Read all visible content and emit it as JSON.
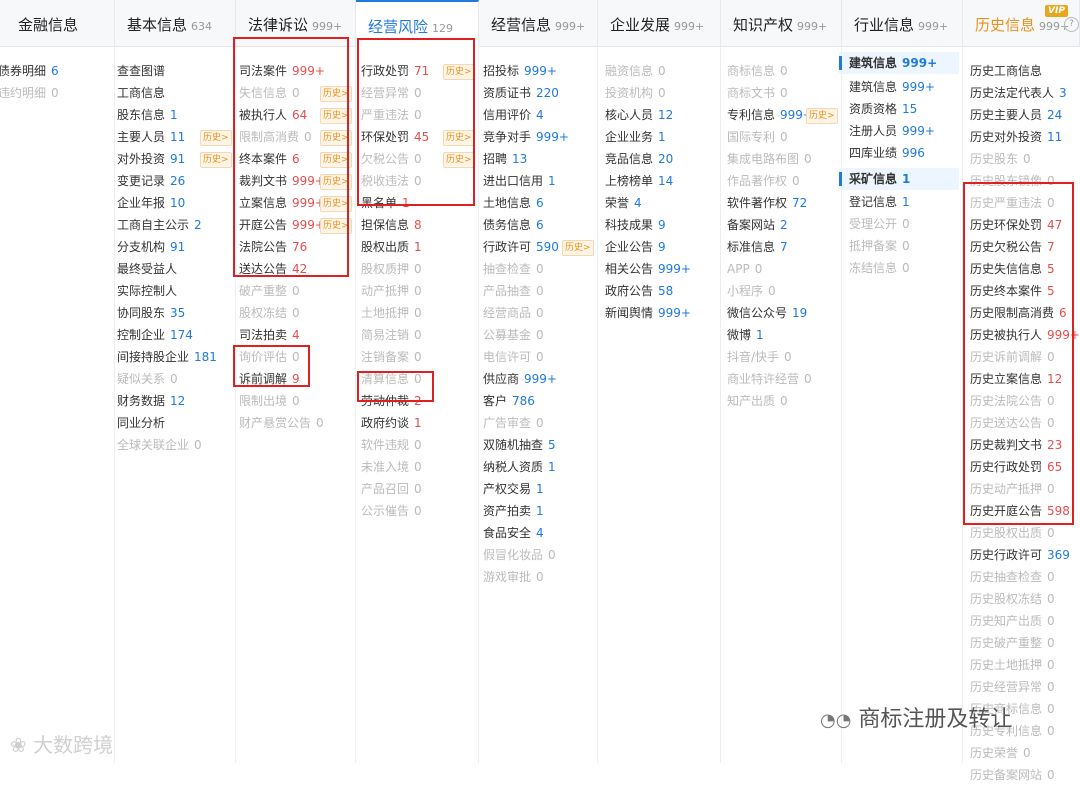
{
  "tabs": [
    {
      "label": "金融信息",
      "count": "",
      "active": false,
      "history": false,
      "vip": ""
    },
    {
      "label": "基本信息",
      "count": "634",
      "active": false,
      "history": false,
      "vip": ""
    },
    {
      "label": "法律诉讼",
      "count": "999+",
      "active": false,
      "history": false,
      "vip": ""
    },
    {
      "label": "经营风险",
      "count": "129",
      "active": true,
      "history": false,
      "vip": ""
    },
    {
      "label": "经营信息",
      "count": "999+",
      "active": false,
      "history": false,
      "vip": ""
    },
    {
      "label": "企业发展",
      "count": "999+",
      "active": false,
      "history": false,
      "vip": ""
    },
    {
      "label": "知识产权",
      "count": "999+",
      "active": false,
      "history": false,
      "vip": ""
    },
    {
      "label": "行业信息",
      "count": "999+",
      "active": false,
      "history": false,
      "vip": ""
    },
    {
      "label": "历史信息",
      "count": "999+",
      "active": false,
      "history": true,
      "vip": "VIP"
    }
  ],
  "columns": [
    [
      {
        "label": "债券明细",
        "count": "6"
      },
      {
        "label": "违约明细",
        "count": "0",
        "disabled": true
      }
    ],
    [
      {
        "label": "查查图谱"
      },
      {
        "label": "工商信息"
      },
      {
        "label": "股东信息",
        "count": "1"
      },
      {
        "label": "主要人员",
        "count": "11",
        "badge": "历史>"
      },
      {
        "label": "对外投资",
        "count": "91",
        "badge": "历史>"
      },
      {
        "label": "变更记录",
        "count": "26"
      },
      {
        "label": "企业年报",
        "count": "10"
      },
      {
        "label": "工商自主公示",
        "count": "2"
      },
      {
        "label": "分支机构",
        "count": "91"
      },
      {
        "label": "最终受益人"
      },
      {
        "label": "实际控制人"
      },
      {
        "label": "协同股东",
        "count": "35"
      },
      {
        "label": "控制企业",
        "count": "174"
      },
      {
        "label": "间接持股企业",
        "count": "181"
      },
      {
        "label": "疑似关系",
        "count": "0",
        "disabled": true
      },
      {
        "label": "财务数据",
        "count": "12"
      },
      {
        "label": "同业分析"
      },
      {
        "label": "全球关联企业",
        "count": "0",
        "disabled": true
      }
    ],
    [
      {
        "label": "司法案件",
        "count": "999+",
        "red": true
      },
      {
        "label": "失信信息",
        "count": "0",
        "disabled": true,
        "badge": "历史>"
      },
      {
        "label": "被执行人",
        "count": "64",
        "red": true,
        "badge": "历史>"
      },
      {
        "label": "限制高消费",
        "count": "0",
        "disabled": true,
        "badge": "历史>"
      },
      {
        "label": "终本案件",
        "count": "6",
        "red": true,
        "badge": "历史>"
      },
      {
        "label": "裁判文书",
        "count": "999+",
        "red": true,
        "badge": "历史>"
      },
      {
        "label": "立案信息",
        "count": "999+",
        "red": true,
        "badge": "历史>"
      },
      {
        "label": "开庭公告",
        "count": "999+",
        "red": true,
        "badge": "历史>"
      },
      {
        "label": "法院公告",
        "count": "76",
        "red": true
      },
      {
        "label": "送达公告",
        "count": "42",
        "red": true
      },
      {
        "label": "破产重整",
        "count": "0",
        "disabled": true
      },
      {
        "label": "股权冻结",
        "count": "0",
        "disabled": true
      },
      {
        "label": "司法拍卖",
        "count": "4",
        "red": true
      },
      {
        "label": "询价评估",
        "count": "0",
        "disabled": true
      },
      {
        "label": "诉前调解",
        "count": "9",
        "red": true
      },
      {
        "label": "限制出境",
        "count": "0",
        "disabled": true
      },
      {
        "label": "财产悬赏公告",
        "count": "0",
        "disabled": true
      }
    ],
    [
      {
        "label": "行政处罚",
        "count": "71",
        "red": true,
        "badge": "历史>"
      },
      {
        "label": "经营异常",
        "count": "0",
        "disabled": true
      },
      {
        "label": "严重违法",
        "count": "0",
        "disabled": true
      },
      {
        "label": "环保处罚",
        "count": "45",
        "red": true,
        "badge": "历史>"
      },
      {
        "label": "欠税公告",
        "count": "0",
        "disabled": true,
        "badge": "历史>"
      },
      {
        "label": "税收违法",
        "count": "0",
        "disabled": true
      },
      {
        "label": "黑名单",
        "count": "1",
        "red": true
      },
      {
        "label": "担保信息",
        "count": "8",
        "red": true
      },
      {
        "label": "股权出质",
        "count": "1",
        "red": true
      },
      {
        "label": "股权质押",
        "count": "0",
        "disabled": true
      },
      {
        "label": "动产抵押",
        "count": "0",
        "disabled": true
      },
      {
        "label": "土地抵押",
        "count": "0",
        "disabled": true
      },
      {
        "label": "简易注销",
        "count": "0",
        "disabled": true
      },
      {
        "label": "注销备案",
        "count": "0",
        "disabled": true
      },
      {
        "label": "清算信息",
        "count": "0",
        "disabled": true
      },
      {
        "label": "劳动仲裁",
        "count": "2",
        "red": true
      },
      {
        "label": "政府约谈",
        "count": "1",
        "red": true
      },
      {
        "label": "软件违规",
        "count": "0",
        "disabled": true
      },
      {
        "label": "未准入境",
        "count": "0",
        "disabled": true
      },
      {
        "label": "产品召回",
        "count": "0",
        "disabled": true
      },
      {
        "label": "公示催告",
        "count": "0",
        "disabled": true
      }
    ],
    [
      {
        "label": "招投标",
        "count": "999+"
      },
      {
        "label": "资质证书",
        "count": "220"
      },
      {
        "label": "信用评价",
        "count": "4"
      },
      {
        "label": "竞争对手",
        "count": "999+"
      },
      {
        "label": "招聘",
        "count": "13"
      },
      {
        "label": "进出口信用",
        "count": "1"
      },
      {
        "label": "土地信息",
        "count": "6"
      },
      {
        "label": "债务信息",
        "count": "6"
      },
      {
        "label": "行政许可",
        "count": "590",
        "badge": "历史>"
      },
      {
        "label": "抽查检查",
        "count": "0",
        "disabled": true
      },
      {
        "label": "产品抽查",
        "count": "0",
        "disabled": true
      },
      {
        "label": "经营商品",
        "count": "0",
        "disabled": true
      },
      {
        "label": "公募基金",
        "count": "0",
        "disabled": true
      },
      {
        "label": "电信许可",
        "count": "0",
        "disabled": true
      },
      {
        "label": "供应商",
        "count": "999+"
      },
      {
        "label": "客户",
        "count": "786"
      },
      {
        "label": "广告审查",
        "count": "0",
        "disabled": true
      },
      {
        "label": "双随机抽查",
        "count": "5"
      },
      {
        "label": "纳税人资质",
        "count": "1"
      },
      {
        "label": "产权交易",
        "count": "1"
      },
      {
        "label": "资产拍卖",
        "count": "1"
      },
      {
        "label": "食品安全",
        "count": "4"
      },
      {
        "label": "假冒化妆品",
        "count": "0",
        "disabled": true
      },
      {
        "label": "游戏审批",
        "count": "0",
        "disabled": true
      }
    ],
    [
      {
        "label": "融资信息",
        "count": "0",
        "disabled": true
      },
      {
        "label": "投资机构",
        "count": "0",
        "disabled": true
      },
      {
        "label": "核心人员",
        "count": "12"
      },
      {
        "label": "企业业务",
        "count": "1"
      },
      {
        "label": "竞品信息",
        "count": "20"
      },
      {
        "label": "上榜榜单",
        "count": "14"
      },
      {
        "label": "荣誉",
        "count": "4"
      },
      {
        "label": "科技成果",
        "count": "9"
      },
      {
        "label": "企业公告",
        "count": "9"
      },
      {
        "label": "相关公告",
        "count": "999+"
      },
      {
        "label": "政府公告",
        "count": "58"
      },
      {
        "label": "新闻舆情",
        "count": "999+"
      }
    ],
    [
      {
        "label": "商标信息",
        "count": "0",
        "disabled": true
      },
      {
        "label": "商标文书",
        "count": "0",
        "disabled": true
      },
      {
        "label": "专利信息",
        "count": "999+",
        "badge": "历史>"
      },
      {
        "label": "国际专利",
        "count": "0",
        "disabled": true
      },
      {
        "label": "集成电路布图",
        "count": "0",
        "disabled": true
      },
      {
        "label": "作品著作权",
        "count": "0",
        "disabled": true
      },
      {
        "label": "软件著作权",
        "count": "72"
      },
      {
        "label": "备案网站",
        "count": "2"
      },
      {
        "label": "标准信息",
        "count": "7"
      },
      {
        "label": "APP",
        "count": "0",
        "disabled": true
      },
      {
        "label": "小程序",
        "count": "0",
        "disabled": true
      },
      {
        "label": "微信公众号",
        "count": "19"
      },
      {
        "label": "微博",
        "count": "1"
      },
      {
        "label": "抖音/快手",
        "count": "0",
        "disabled": true
      },
      {
        "label": "商业特许经营",
        "count": "0",
        "disabled": true
      },
      {
        "label": "知产出质",
        "count": "0",
        "disabled": true
      }
    ],
    [
      {
        "label": "建筑信息",
        "count": "999+",
        "selected": true
      },
      {
        "label": "建筑信息",
        "count": "999+"
      },
      {
        "label": "资质资格",
        "count": "15"
      },
      {
        "label": "注册人员",
        "count": "999+"
      },
      {
        "label": "四库业绩",
        "count": "996"
      },
      {
        "label": "采矿信息",
        "count": "1",
        "selected": true
      },
      {
        "label": "登记信息",
        "count": "1"
      },
      {
        "label": "受理公开",
        "count": "0",
        "disabled": true
      },
      {
        "label": "抵押备案",
        "count": "0",
        "disabled": true
      },
      {
        "label": "冻结信息",
        "count": "0",
        "disabled": true
      }
    ],
    [
      {
        "label": "历史工商信息"
      },
      {
        "label": "历史法定代表人",
        "count": "3"
      },
      {
        "label": "历史主要人员",
        "count": "24"
      },
      {
        "label": "历史对外投资",
        "count": "11"
      },
      {
        "label": "历史股东",
        "count": "0",
        "disabled": true
      },
      {
        "label": "历史股东镜像",
        "count": "0",
        "disabled": true
      },
      {
        "label": "历史严重违法",
        "count": "0",
        "disabled": true
      },
      {
        "label": "历史环保处罚",
        "count": "47",
        "red": true
      },
      {
        "label": "历史欠税公告",
        "count": "7",
        "red": true
      },
      {
        "label": "历史失信信息",
        "count": "5",
        "red": true
      },
      {
        "label": "历史终本案件",
        "count": "5",
        "red": true
      },
      {
        "label": "历史限制高消费",
        "count": "6",
        "red": true
      },
      {
        "label": "历史被执行人",
        "count": "999+",
        "red": true
      },
      {
        "label": "历史诉前调解",
        "count": "0",
        "disabled": true
      },
      {
        "label": "历史立案信息",
        "count": "12",
        "red": true
      },
      {
        "label": "历史法院公告",
        "count": "0",
        "disabled": true
      },
      {
        "label": "历史送达公告",
        "count": "0",
        "disabled": true
      },
      {
        "label": "历史裁判文书",
        "count": "23",
        "red": true
      },
      {
        "label": "历史行政处罚",
        "count": "65",
        "red": true
      },
      {
        "label": "历史动产抵押",
        "count": "0",
        "disabled": true
      },
      {
        "label": "历史开庭公告",
        "count": "598",
        "red": true
      },
      {
        "label": "历史股权出质",
        "count": "0",
        "disabled": true
      },
      {
        "label": "历史行政许可",
        "count": "369"
      },
      {
        "label": "历史抽查检查",
        "count": "0",
        "disabled": true
      },
      {
        "label": "历史股权冻结",
        "count": "0",
        "disabled": true
      },
      {
        "label": "历史知产出质",
        "count": "0",
        "disabled": true
      },
      {
        "label": "历史破产重整",
        "count": "0",
        "disabled": true
      },
      {
        "label": "历史土地抵押",
        "count": "0",
        "disabled": true
      },
      {
        "label": "历史经营异常",
        "count": "0",
        "disabled": true
      },
      {
        "label": "历史商标信息",
        "count": "0",
        "disabled": true
      },
      {
        "label": "历史专利信息",
        "count": "0",
        "disabled": true
      },
      {
        "label": "历史荣誉",
        "count": "0",
        "disabled": true
      },
      {
        "label": "历史备案网站",
        "count": "0",
        "disabled": true
      }
    ]
  ],
  "watermarks": {
    "left": "大数跨境",
    "right": "商标注册及转让"
  },
  "colors": {
    "accent": "#1f7ae0",
    "red": "#e84d4d",
    "disabled": "#bbbbbb",
    "history": "#e8921d",
    "highlight_box": "#e02020"
  }
}
